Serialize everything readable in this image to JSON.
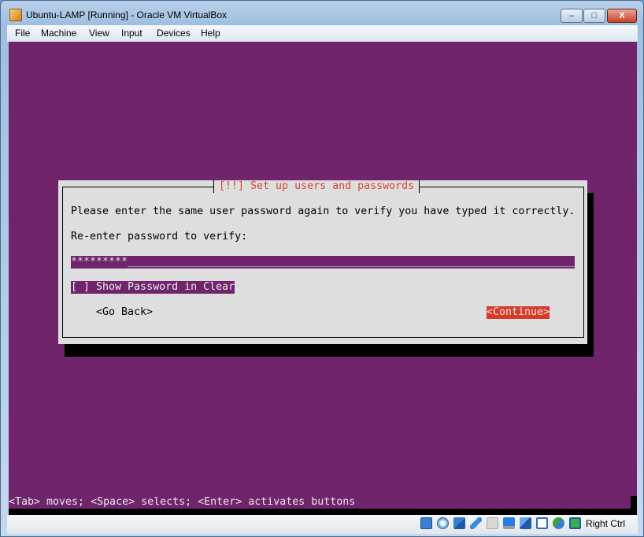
{
  "window": {
    "title": "Ubuntu-LAMP [Running] - Oracle VM VirtualBox",
    "minimize": "–",
    "maximize": "□",
    "close": "X"
  },
  "menu": [
    "File",
    "Machine",
    "View",
    "Input",
    "Devices",
    "Help"
  ],
  "dialog": {
    "title": "[!!] Set up users and passwords",
    "message": "Please enter the same user password again to verify you have typed it correctly.",
    "prompt": "Re-enter password to verify:",
    "password_value": "*********",
    "field_fill": "_______________________________________________________________________",
    "checkbox_label": "[ ] Show Password in Clear",
    "go_back": "<Go Back>",
    "continue": "<Continue>"
  },
  "help_line": "<Tab> moves; <Space> selects; <Enter> activates buttons",
  "statusbar": {
    "icons": [
      "hard-disk-icon",
      "optical-disk-icon",
      "network-icon",
      "usb-icon",
      "shared-folders-icon",
      "display-icon",
      "capture-icon",
      "virtualization-icon",
      "mouse-integration-icon",
      "keyboard-capture-icon"
    ],
    "host_key": "Right Ctrl"
  },
  "colors": {
    "background": "#6f246b",
    "dialog": "#dedede",
    "title": "#d8453a",
    "button_selected": "#d43b2c"
  }
}
